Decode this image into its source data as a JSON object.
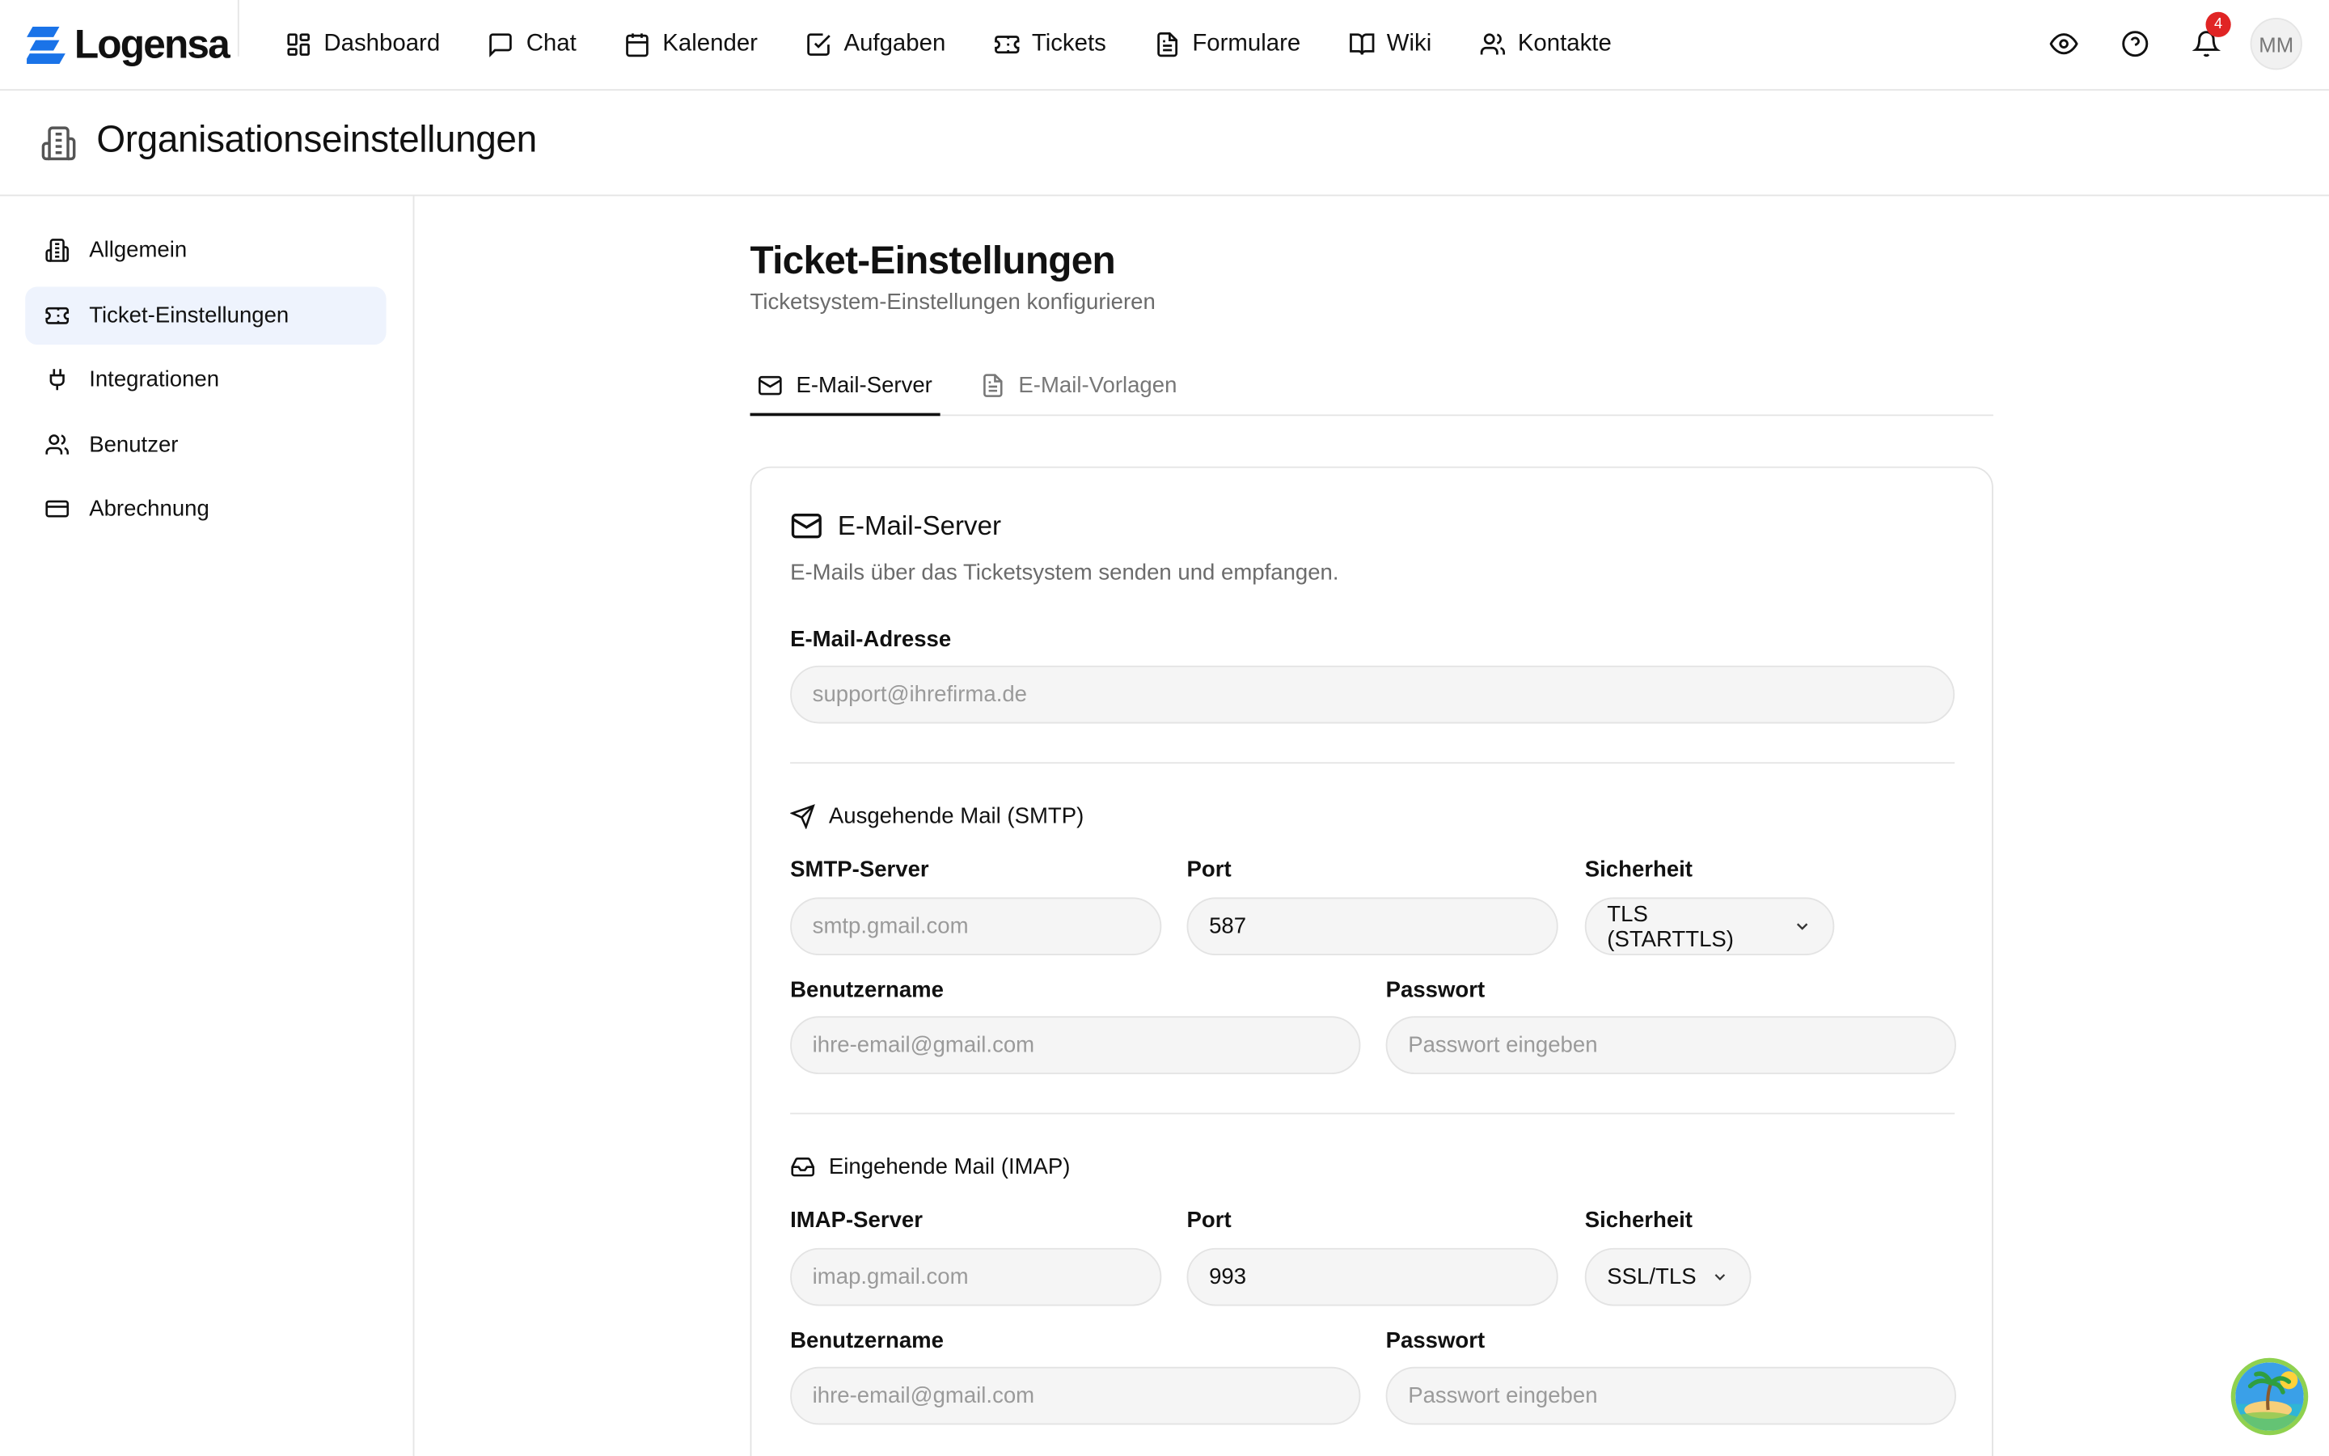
{
  "app": {
    "logo_text": "Logensa",
    "brand_color": "#1a73e8"
  },
  "topnav": {
    "items": [
      {
        "label": "Dashboard",
        "icon": "dashboard-icon"
      },
      {
        "label": "Chat",
        "icon": "chat-icon"
      },
      {
        "label": "Kalender",
        "icon": "calendar-icon"
      },
      {
        "label": "Aufgaben",
        "icon": "checkbox-icon"
      },
      {
        "label": "Tickets",
        "icon": "ticket-icon"
      },
      {
        "label": "Formulare",
        "icon": "file-icon"
      },
      {
        "label": "Wiki",
        "icon": "book-icon"
      },
      {
        "label": "Kontakte",
        "icon": "users-icon"
      }
    ],
    "notification_count": "4",
    "avatar_initials": "MM"
  },
  "page": {
    "title": "Organisationseinstellungen"
  },
  "sidebar": {
    "items": [
      {
        "label": "Allgemein",
        "icon": "building-icon",
        "active": false
      },
      {
        "label": "Ticket-Einstellungen",
        "icon": "ticket-icon",
        "active": true
      },
      {
        "label": "Integrationen",
        "icon": "plug-icon",
        "active": false
      },
      {
        "label": "Benutzer",
        "icon": "users-icon",
        "active": false
      },
      {
        "label": "Abrechnung",
        "icon": "credit-card-icon",
        "active": false
      }
    ]
  },
  "main": {
    "title": "Ticket-Einstellungen",
    "subtitle": "Ticketsystem-Einstellungen konfigurieren",
    "tabs": [
      {
        "label": "E-Mail-Server",
        "icon": "mail-icon",
        "active": true
      },
      {
        "label": "E-Mail-Vorlagen",
        "icon": "file-icon",
        "active": false
      }
    ]
  },
  "card": {
    "title": "E-Mail-Server",
    "description": "E-Mails über das Ticketsystem senden und empfangen.",
    "email_label": "E-Mail-Adresse",
    "email_placeholder": "support@ihrefirma.de",
    "smtp": {
      "heading": "Ausgehende Mail (SMTP)",
      "server_label": "SMTP-Server",
      "server_placeholder": "smtp.gmail.com",
      "port_label": "Port",
      "port_value": "587",
      "security_label": "Sicherheit",
      "security_value": "TLS (STARTTLS)",
      "username_label": "Benutzername",
      "username_placeholder": "ihre-email@gmail.com",
      "password_label": "Passwort",
      "password_placeholder": "Passwort eingeben"
    },
    "imap": {
      "heading": "Eingehende Mail (IMAP)",
      "server_label": "IMAP-Server",
      "server_placeholder": "imap.gmail.com",
      "port_label": "Port",
      "port_value": "993",
      "security_label": "Sicherheit",
      "security_value": "SSL/TLS",
      "username_label": "Benutzername",
      "username_placeholder": "ihre-email@gmail.com",
      "password_label": "Passwort",
      "password_placeholder": "Passwort eingeben"
    }
  }
}
